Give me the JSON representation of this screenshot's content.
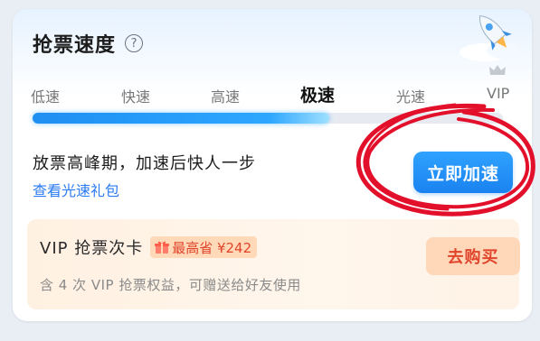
{
  "header": {
    "title": "抢票速度",
    "help_icon": "question-circle-icon"
  },
  "speed_levels": [
    "低速",
    "快速",
    "高速",
    "极速",
    "光速",
    "VIP"
  ],
  "current_level": "极速",
  "progress_fraction": 0.63,
  "peak": {
    "message": "放票高峰期，加速后快人一步",
    "link_text": "查看光速礼包",
    "button_label": "立即加速"
  },
  "vip_card": {
    "title": "VIP 抢票次卡",
    "badge_text": "最高省 ¥242",
    "description": "含 4 次 VIP 抢票权益，可赠送给好友使用",
    "button_label": "去购买"
  },
  "colors": {
    "accent_blue": "#1a82f0",
    "link_blue": "#2a7bf0",
    "vip_red": "#e0452c",
    "annotation_red": "#e3102b"
  },
  "icons": [
    "question-circle-icon",
    "rocket-icon",
    "crown-icon",
    "gift-icon",
    "chevron-down-icon"
  ]
}
